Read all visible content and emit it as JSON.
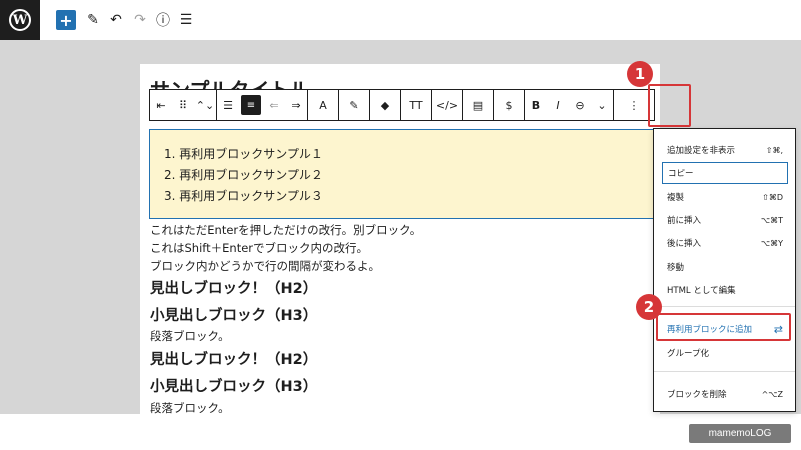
{
  "topbar": {
    "logo": "W",
    "add_label": "+",
    "edit_icon": "✎",
    "undo_icon": "↶",
    "redo_icon": "↷",
    "info_icon": "ⓘ",
    "outline_icon": "☰"
  },
  "post": {
    "title": "サンプルタイトル"
  },
  "block_toolbar": {
    "groups": [
      [
        "⇤",
        "⠿",
        "⌃⌄"
      ],
      [
        "☰",
        "≡",
        "⇐",
        "⇒"
      ],
      [
        "A"
      ],
      [
        "✎"
      ],
      [
        "◆"
      ],
      [
        "TT"
      ],
      [
        "</>"
      ],
      [
        "▤"
      ],
      [
        "$"
      ],
      [
        "B",
        "I",
        "⊖",
        "⌄"
      ],
      [
        "⋮"
      ]
    ]
  },
  "list": {
    "items": [
      "1. 再利用ブロックサンプル１",
      "2. 再利用ブロックサンプル２",
      "3. 再利用ブロックサンプル３"
    ]
  },
  "content": {
    "para1_line1": "これはただEnterを押しただけの改行。別ブロック。",
    "para1_line2": "これはShift＋Enterでブロック内の改行。",
    "para1_line3": "ブロック内かどうかで行の間隔が変わるよ。",
    "h2_a": "見出しブロック！（H2）",
    "h3_a": "小見出しブロック（H3）",
    "p_a": "段落ブロック。",
    "h2_b": "見出しブロック！（H2）",
    "h3_b": "小見出しブロック（H3）",
    "p_b": "段落ブロック。"
  },
  "menu": {
    "items": [
      {
        "label": "追加設定を非表示",
        "shortcut": "⇧⌘,"
      },
      {
        "label": "コピー",
        "shortcut": ""
      },
      {
        "label": "複製",
        "shortcut": "⇧⌘D"
      },
      {
        "label": "前に挿入",
        "shortcut": "⌥⌘T"
      },
      {
        "label": "後に挿入",
        "shortcut": "⌥⌘Y"
      },
      {
        "label": "移動",
        "shortcut": ""
      },
      {
        "label": "HTML として編集",
        "shortcut": ""
      },
      {
        "label": "再利用ブロックに追加",
        "shortcut": "⇄"
      },
      {
        "label": "グループ化",
        "shortcut": ""
      },
      {
        "label": "ブロックを削除",
        "shortcut": "^⌥Z"
      }
    ]
  },
  "badges": {
    "one": "1",
    "two": "2"
  },
  "colors": {
    "accent": "#2271b1",
    "highlight": "#d63638",
    "list_bg": "#fdf5cf"
  },
  "watermark": "mamemoLOG"
}
